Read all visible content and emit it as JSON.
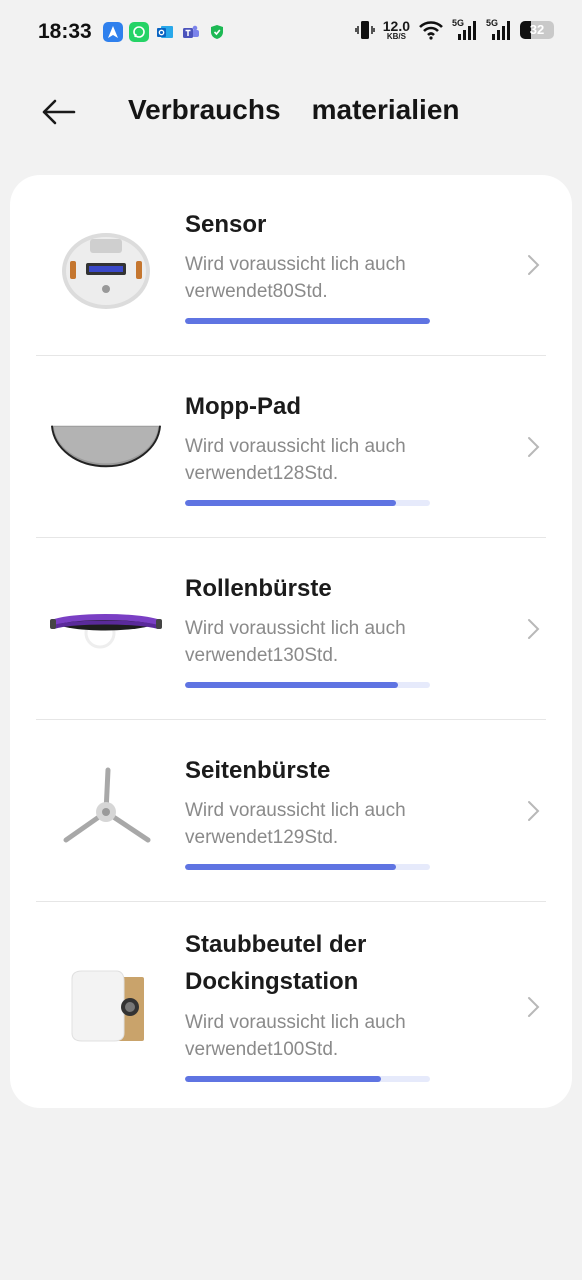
{
  "status": {
    "time": "18:33",
    "net_speed_value": "12.0",
    "net_speed_unit": "KB/S",
    "signal_1_tag": "5G",
    "signal_2_tag": "5G",
    "battery_level": "32"
  },
  "header": {
    "title": "Verbrauchs    materialien"
  },
  "consumables": [
    {
      "name": "Sensor",
      "desc_line1": "Wird voraussicht lich auch",
      "desc_line2": "verwendet80Std.",
      "remaining_pct": 100
    },
    {
      "name": "Mopp-Pad",
      "desc_line1": "Wird voraussicht lich auch",
      "desc_line2": "verwendet128Std.",
      "remaining_pct": 86
    },
    {
      "name": "Rollenbürste",
      "desc_line1": "Wird voraussicht lich auch",
      "desc_line2": "verwendet130Std.",
      "remaining_pct": 87
    },
    {
      "name": "Seitenbürste",
      "desc_line1": "Wird voraussicht lich auch",
      "desc_line2": "verwendet129Std.",
      "remaining_pct": 86
    },
    {
      "name_line1": "Staubbeutel der",
      "name_line2": "Dockingstation",
      "desc_line1": "Wird voraussicht lich auch",
      "desc_line2": "verwendet100Std.",
      "remaining_pct": 80
    }
  ],
  "colors": {
    "progress_fill": "#5f74e2",
    "progress_track": "#e6eafb",
    "background": "#f2f2f2",
    "card": "#ffffff"
  }
}
